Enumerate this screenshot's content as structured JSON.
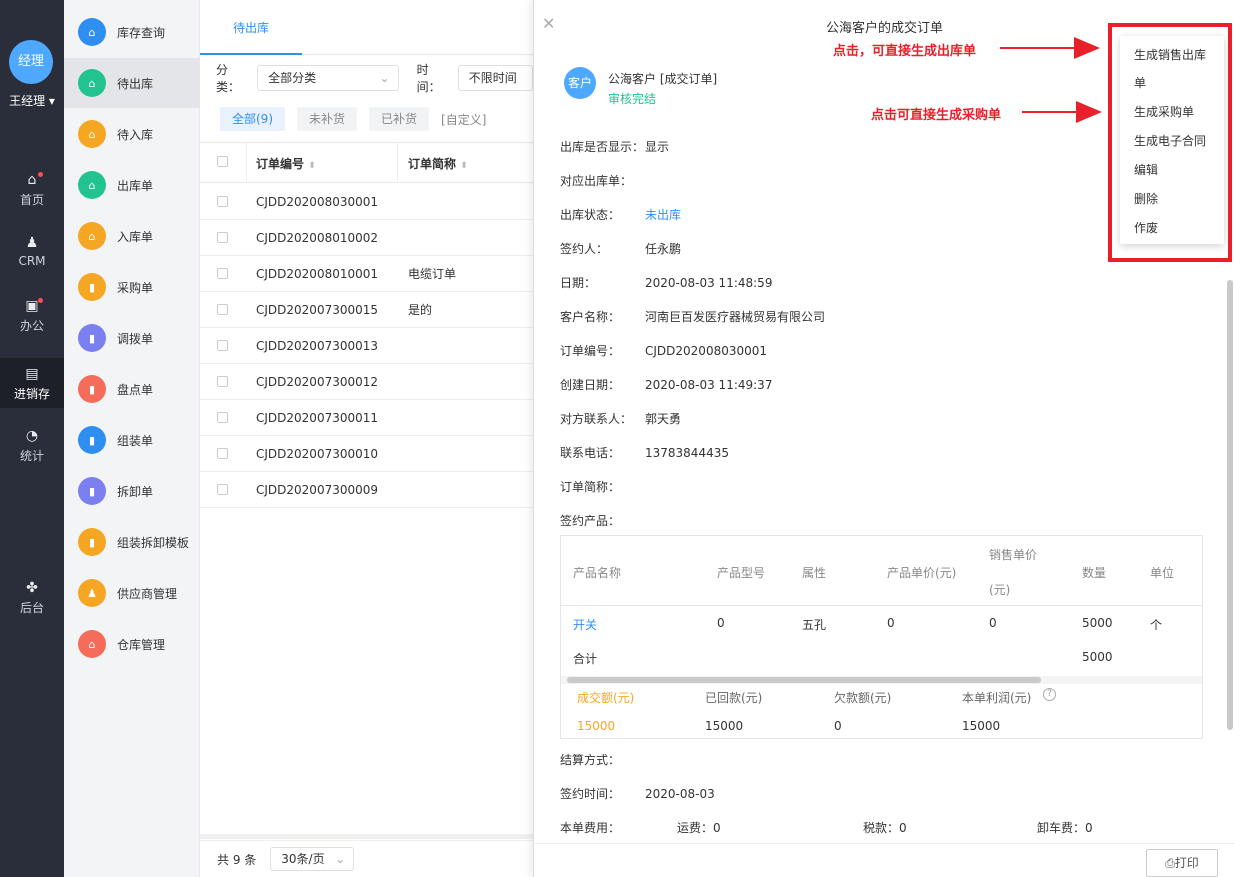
{
  "nav": {
    "avatar": "经理",
    "user": "王经理",
    "items": [
      {
        "label": "首页",
        "icon": "home-icon"
      },
      {
        "label": "CRM",
        "icon": "crm-icon"
      },
      {
        "label": "办公",
        "icon": "office-icon"
      },
      {
        "label": "进销存",
        "icon": "inventory-icon"
      },
      {
        "label": "统计",
        "icon": "stats-icon"
      },
      {
        "label": "后台",
        "icon": "backend-icon"
      }
    ]
  },
  "submenu": [
    {
      "label": "库存查询",
      "color": "#2f8ff0"
    },
    {
      "label": "待出库",
      "color": "#22c38e"
    },
    {
      "label": "待入库",
      "color": "#f5a623"
    },
    {
      "label": "出库单",
      "color": "#22c38e"
    },
    {
      "label": "入库单",
      "color": "#f5a623"
    },
    {
      "label": "采购单",
      "color": "#f5a623"
    },
    {
      "label": "调拨单",
      "color": "#7b7ff0"
    },
    {
      "label": "盘点单",
      "color": "#f56c5a"
    },
    {
      "label": "组装单",
      "color": "#2f8ff0"
    },
    {
      "label": "拆卸单",
      "color": "#7b7ff0"
    },
    {
      "label": "组装拆卸模板",
      "color": "#f5a623"
    },
    {
      "label": "供应商管理",
      "color": "#f5a623"
    },
    {
      "label": "仓库管理",
      "color": "#f56c5a"
    }
  ],
  "list": {
    "tab": "待出库",
    "filter_label": "分类：",
    "filter_value": "全部分类",
    "time_label": "时间：",
    "time_value": "不限时间",
    "chips": [
      "全部(9)",
      "未补货",
      "已补货",
      "[自定义]"
    ],
    "col1": "订单编号",
    "col2": "订单简称",
    "rows": [
      {
        "no": "CJDD202008030001",
        "name": ""
      },
      {
        "no": "CJDD202008010002",
        "name": ""
      },
      {
        "no": "CJDD202008010001",
        "name": "电缆订单"
      },
      {
        "no": "CJDD202007300015",
        "name": "是的"
      },
      {
        "no": "CJDD202007300013",
        "name": ""
      },
      {
        "no": "CJDD202007300012",
        "name": ""
      },
      {
        "no": "CJDD202007300011",
        "name": ""
      },
      {
        "no": "CJDD202007300010",
        "name": ""
      },
      {
        "no": "CJDD202007300009",
        "name": ""
      }
    ],
    "total": "共 9 条",
    "page_size": "30条/页"
  },
  "panel": {
    "title": "公海客户的成交订单",
    "avatar": "客户",
    "source": "公海客户 [成交订单]",
    "status": "审核完结",
    "fields": [
      {
        "k": "出库是否显示：",
        "v": "显示"
      },
      {
        "k": "对应出库单：",
        "v": ""
      },
      {
        "k": "出库状态：",
        "v": "未出库"
      },
      {
        "k": "签约人：",
        "v": "任永鹏"
      },
      {
        "k": "日期：",
        "v": "2020-08-03 11:48:59"
      },
      {
        "k": "客户名称：",
        "v": "河南巨百发医疗器械贸易有限公司"
      },
      {
        "k": "订单编号：",
        "v": "CJDD202008030001"
      },
      {
        "k": "创建日期：",
        "v": "2020-08-03 11:49:37"
      },
      {
        "k": "对方联系人：",
        "v": "郭天勇"
      },
      {
        "k": "联系电话：",
        "v": "13783844435"
      },
      {
        "k": "订单简称：",
        "v": ""
      },
      {
        "k": "签约产品：",
        "v": ""
      }
    ],
    "table": {
      "headers": [
        "产品名称",
        "产品型号",
        "属性",
        "产品单价(元)",
        "销售单价",
        "(元)",
        "数量",
        "单位"
      ],
      "row": [
        "开关",
        "0",
        "五孔",
        "0",
        "0",
        "5000",
        "个"
      ],
      "total_label": "合计",
      "total_qty": "5000",
      "sum_headers": [
        "成交额(元)",
        "已回款(元)",
        "欠款额(元)",
        "本单利润(元)"
      ],
      "sum_values": [
        "15000",
        "15000",
        "0",
        "15000"
      ]
    },
    "settle": "结算方式：",
    "sign_time_label": "签约时间：",
    "sign_time": "2020-08-03",
    "fee_label": "本单费用：",
    "fees": [
      "运费：0",
      "税款：0",
      "卸车费：0"
    ],
    "print": "打印"
  },
  "menu": {
    "items": [
      "生成销售出库",
      "单",
      "生成采购单",
      "生成电子合同",
      "编辑",
      "删除",
      "作废"
    ]
  },
  "annotations": {
    "a1": "点击，可直接生成出库单",
    "a2": "点击可直接生成采购单"
  }
}
